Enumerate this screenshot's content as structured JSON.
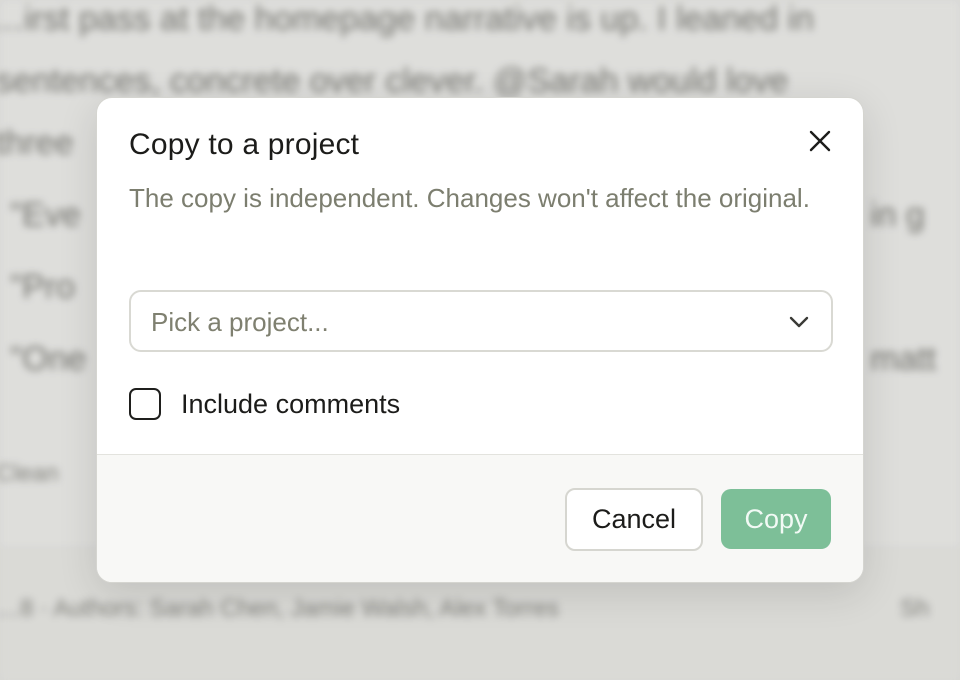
{
  "background": {
    "lines": [
      "…irst pass at the homepage narrative is up. I leaned in",
      "sentences, concrete over clever. @Sarah would love",
      "three",
      "\"Eve",
      "\"Pro",
      "\"One"
    ],
    "right_fragments": [
      "in g",
      "matt"
    ],
    "small_text": "Clean",
    "footer_text": "…8 · Authors: Sarah Chen, Jamie Walsh, Alex Torres",
    "footer_right": "Sh"
  },
  "dialog": {
    "title": "Copy to a project",
    "description": "The copy is independent. Changes won't affect the original.",
    "close_icon": "close-icon",
    "project_select": {
      "placeholder": "Pick a project...",
      "icon": "chevron-down-icon"
    },
    "include_comments": {
      "label": "Include comments",
      "checked": false
    },
    "buttons": {
      "cancel": "Cancel",
      "copy": "Copy"
    }
  },
  "colors": {
    "primary_button": "#7dbf98",
    "description_text": "#7c7e6f"
  }
}
